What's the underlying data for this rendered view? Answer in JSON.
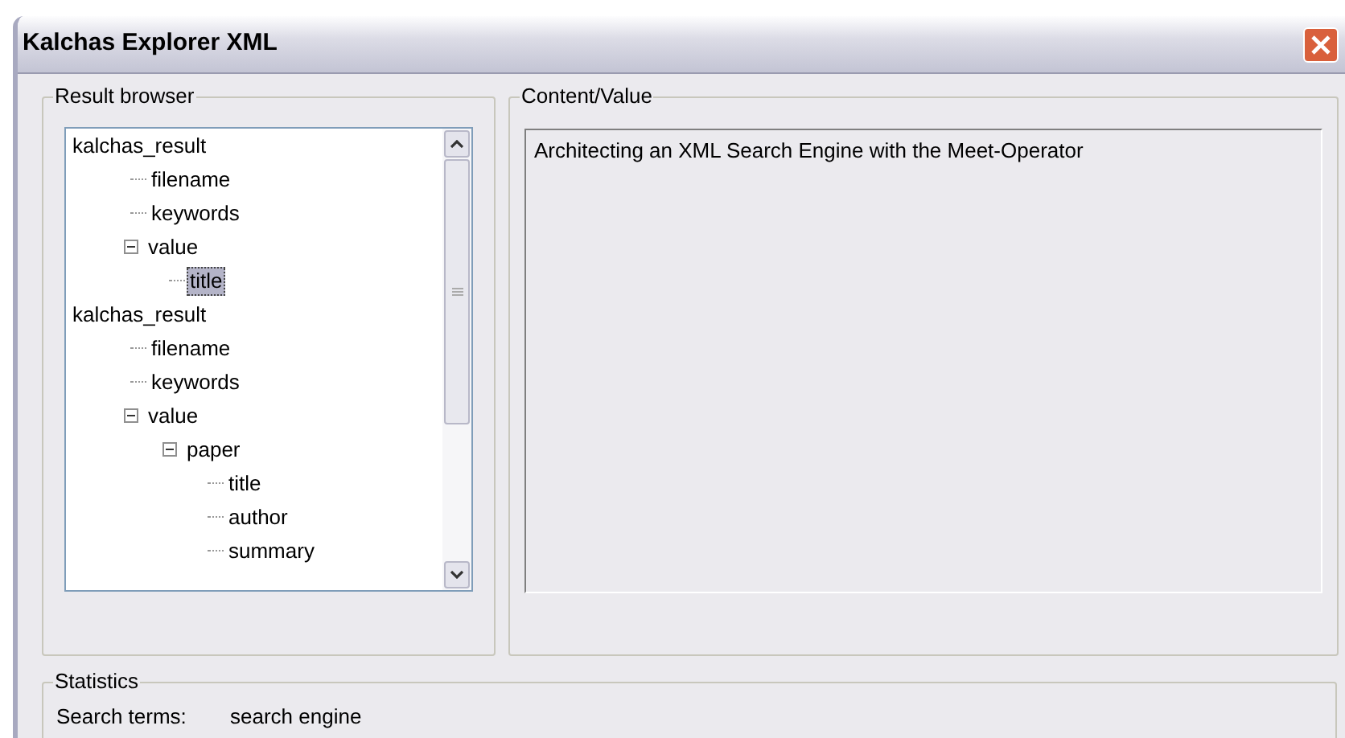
{
  "window": {
    "title": "Kalchas Explorer XML"
  },
  "result_browser": {
    "label": "Result browser",
    "tree": [
      {
        "label": "kalchas_result",
        "selected": false,
        "children": [
          {
            "label": "filename",
            "selected": false
          },
          {
            "label": "keywords",
            "selected": false
          },
          {
            "label": "value",
            "selected": false,
            "expanded": true,
            "children": [
              {
                "label": "title",
                "selected": true
              }
            ]
          }
        ]
      },
      {
        "label": "kalchas_result",
        "selected": false,
        "children": [
          {
            "label": "filename",
            "selected": false
          },
          {
            "label": "keywords",
            "selected": false
          },
          {
            "label": "value",
            "selected": false,
            "expanded": true,
            "children": [
              {
                "label": "paper",
                "selected": false,
                "expanded": true,
                "children": [
                  {
                    "label": "title",
                    "selected": false
                  },
                  {
                    "label": "author",
                    "selected": false
                  },
                  {
                    "label": "summary",
                    "selected": false
                  }
                ]
              }
            ]
          }
        ]
      }
    ]
  },
  "content": {
    "label": "Content/Value",
    "value": "Architecting an XML Search Engine with the Meet-Operator"
  },
  "statistics": {
    "label": "Statistics",
    "search_terms_label": "Search terms:",
    "search_terms": "search engine"
  }
}
